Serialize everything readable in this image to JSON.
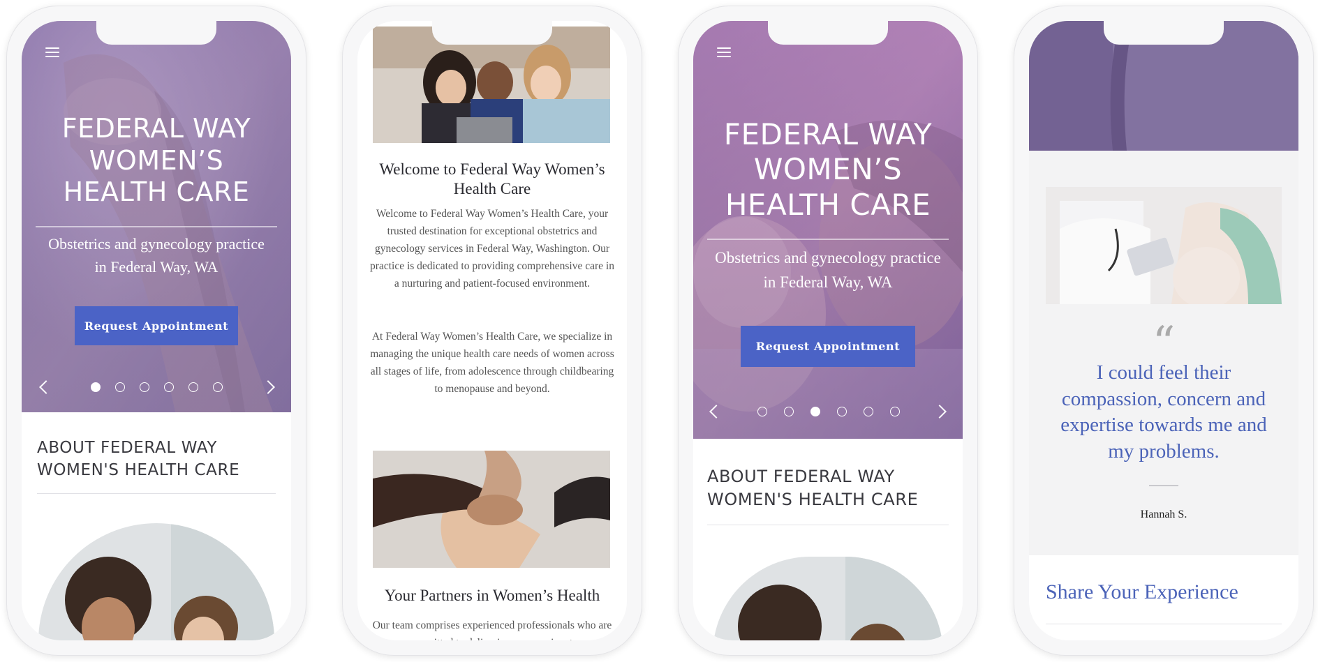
{
  "site": {
    "hero_title": "FEDERAL WAY\nWOMEN’S\nHEALTH CARE",
    "hero_subtitle": "Obstetrics and gynecology practice\nin Federal Way, WA",
    "cta_label": "Request Appointment",
    "about_title": "ABOUT FEDERAL WAY\nWOMEN'S HEALTH CARE",
    "slide_count": 6
  },
  "phone1": {
    "active_slide": 1
  },
  "phone3": {
    "active_slide": 3
  },
  "phone2": {
    "welcome_heading": "Welcome to Federal Way Women’s Health Care",
    "welcome_p1": "Welcome to Federal Way Women’s Health Care, your trusted destination for exceptional obstetrics and gynecology services in Federal Way, Washington. Our practice is dedicated to providing comprehensive care in a nurturing and patient-focused environment.",
    "welcome_p2": "At Federal Way Women’s Health Care, we specialize in managing the unique health care needs of women across all stages of life, from adolescence through childbearing to menopause and beyond.",
    "partners_heading": "Your Partners in Women’s Health",
    "partners_p": "Our team comprises experienced professionals who are committed to delivering compassionate"
  },
  "phone4": {
    "quote_mark": "“",
    "quote": "I could feel their compassion, concern and expertise towards me and my problems.",
    "author": "Hannah S.",
    "share_title": "Share Your Experience"
  },
  "colors": {
    "accent_blue": "#4b63c6",
    "hero_overlay": "#7e64aa",
    "quote_blue": "#4b63b8"
  }
}
